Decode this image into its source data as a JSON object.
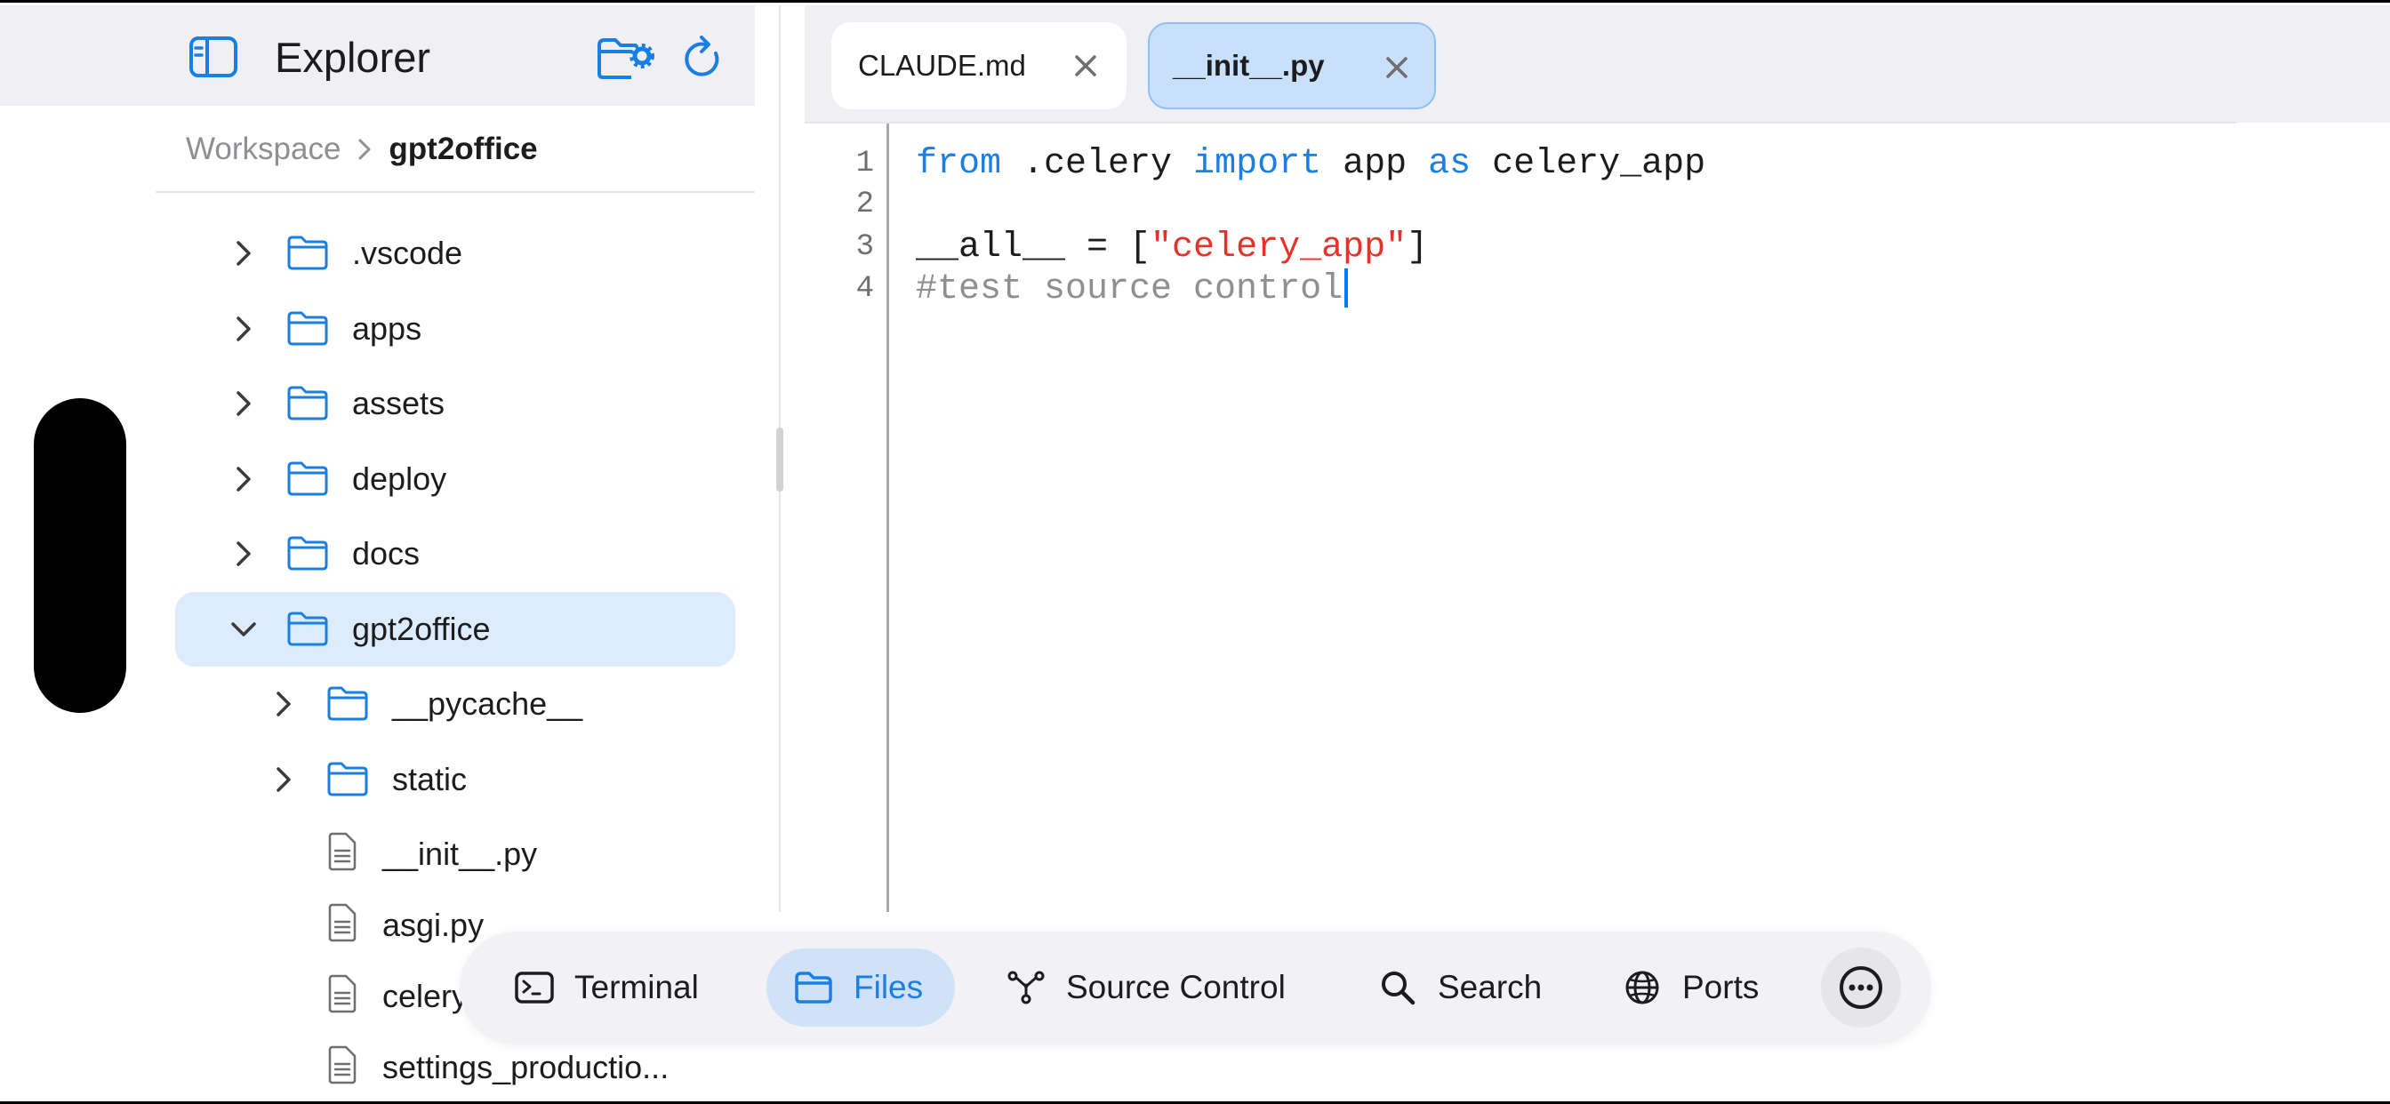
{
  "sidebar": {
    "title": "Explorer",
    "breadcrumb": {
      "root": "Workspace",
      "current": "gpt2office"
    },
    "tree": [
      {
        "label": ".vscode",
        "type": "folder",
        "expanded": false,
        "depth": 0
      },
      {
        "label": "apps",
        "type": "folder",
        "expanded": false,
        "depth": 0
      },
      {
        "label": "assets",
        "type": "folder",
        "expanded": false,
        "depth": 0
      },
      {
        "label": "deploy",
        "type": "folder",
        "expanded": false,
        "depth": 0
      },
      {
        "label": "docs",
        "type": "folder",
        "expanded": false,
        "depth": 0
      },
      {
        "label": "gpt2office",
        "type": "folder",
        "expanded": true,
        "depth": 0,
        "selected": true
      },
      {
        "label": "__pycache__",
        "type": "folder",
        "expanded": false,
        "depth": 1
      },
      {
        "label": "static",
        "type": "folder",
        "expanded": false,
        "depth": 1
      },
      {
        "label": "__init__.py",
        "type": "file",
        "depth": 1
      },
      {
        "label": "asgi.py",
        "type": "file",
        "depth": 1
      },
      {
        "label": "celery.py",
        "type": "file",
        "depth": 1
      },
      {
        "label": "settings_productio...",
        "type": "file",
        "depth": 1
      }
    ]
  },
  "editor": {
    "tabs": [
      {
        "label": "CLAUDE.md",
        "active": false
      },
      {
        "label": "__init__.py",
        "active": true
      }
    ],
    "lines": [
      {
        "num": "1",
        "tokens": [
          {
            "t": "from",
            "c": "kw"
          },
          {
            "t": " .celery ",
            "c": ""
          },
          {
            "t": "import",
            "c": "kw"
          },
          {
            "t": " app ",
            "c": ""
          },
          {
            "t": "as",
            "c": "kw"
          },
          {
            "t": " celery_app",
            "c": ""
          }
        ]
      },
      {
        "num": "2",
        "tokens": []
      },
      {
        "num": "3",
        "tokens": [
          {
            "t": "__all__ = [",
            "c": ""
          },
          {
            "t": "\"celery_app\"",
            "c": "str"
          },
          {
            "t": "]",
            "c": ""
          }
        ]
      },
      {
        "num": "4",
        "tokens": [
          {
            "t": "#test source control",
            "c": "comment"
          }
        ],
        "caret": true
      }
    ]
  },
  "dock": {
    "items": [
      {
        "label": "Terminal",
        "icon": "terminal-icon",
        "active": false
      },
      {
        "label": "Files",
        "icon": "folder-icon",
        "active": true
      },
      {
        "label": "Source Control",
        "icon": "source-control-icon",
        "active": false
      },
      {
        "label": "Search",
        "icon": "search-icon",
        "active": false
      },
      {
        "label": "Ports",
        "icon": "globe-icon",
        "active": false
      }
    ]
  },
  "colors": {
    "accent": "#007aff",
    "keyword": "#1a7fe0",
    "string": "#e5322b",
    "comment": "#8e8e93",
    "selection": "#dcecfc"
  }
}
